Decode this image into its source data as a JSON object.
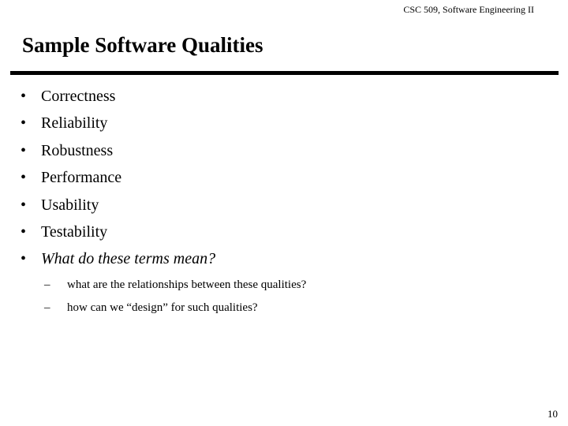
{
  "slide": {
    "header": "CSC 509, Software Engineering II",
    "title": "Sample Software Qualities",
    "page_number": "10",
    "bullet_marker": "•",
    "sub_marker": "–",
    "bullets": [
      {
        "text": "Correctness",
        "style": "regular"
      },
      {
        "text": "Reliability",
        "style": "regular"
      },
      {
        "text": "Robustness",
        "style": "regular"
      },
      {
        "text": "Performance",
        "style": "regular"
      },
      {
        "text": "Usability",
        "style": "regular"
      },
      {
        "text": "Testability",
        "style": "regular"
      },
      {
        "text": "What do these terms mean?",
        "style": "italic"
      }
    ],
    "sub_bullets": [
      {
        "text": "what are the relationships between these qualities?"
      },
      {
        "text": "how can we “design” for such qualities?"
      }
    ],
    "colors": {
      "background": "#ffffff",
      "text": "#000000",
      "rule": "#000000"
    }
  }
}
